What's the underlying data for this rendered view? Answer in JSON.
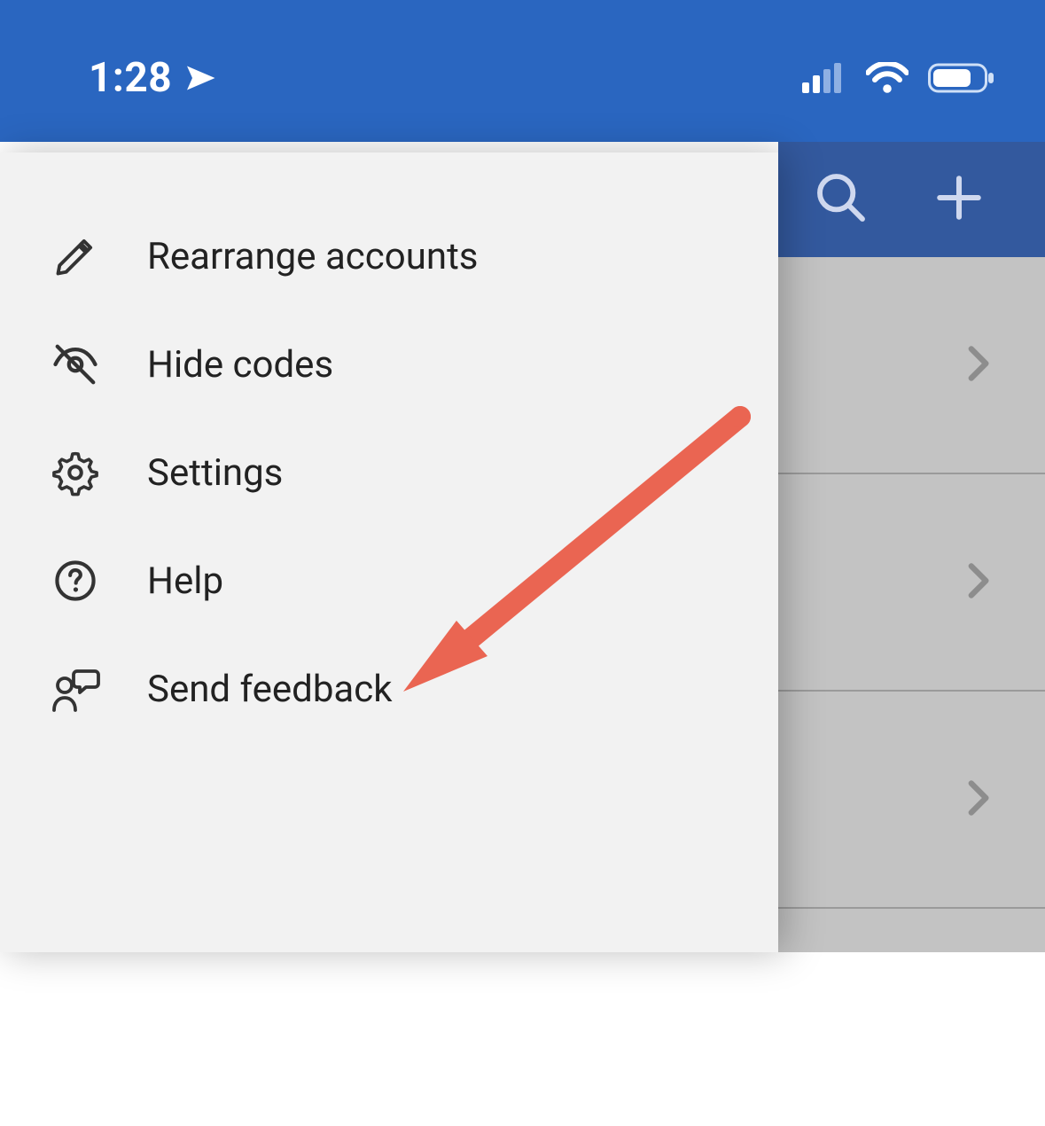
{
  "status": {
    "time": "1:28"
  },
  "menu": {
    "items": [
      {
        "label": "Rearrange accounts"
      },
      {
        "label": "Hide codes"
      },
      {
        "label": "Settings"
      },
      {
        "label": "Help"
      },
      {
        "label": "Send feedback"
      }
    ]
  },
  "annotation": {
    "target": "Send feedback"
  },
  "colors": {
    "statusbar": "#2a66c0",
    "under_header": "#33599e",
    "menu_bg": "#f2f2f2",
    "under_list": "#c3c3c3",
    "arrow": "#ea6552"
  }
}
